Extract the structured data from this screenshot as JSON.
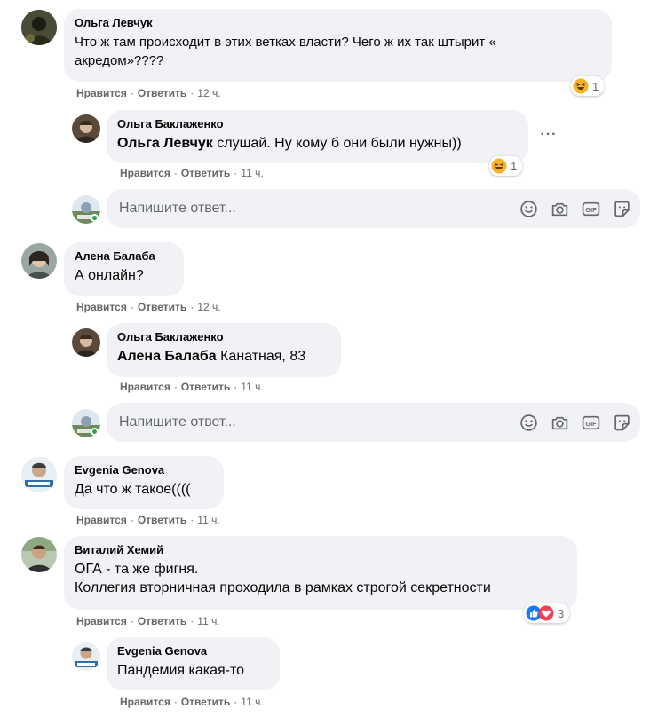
{
  "actions": {
    "like": "Нравится",
    "reply": "Ответить",
    "separator": "·"
  },
  "reply_input": {
    "placeholder": "Напишите ответ..."
  },
  "comments": [
    {
      "author": "Ольга Левчук",
      "text_line1": "Что ж там происходит в этих ветках власти? Чего ж их так штырит «",
      "text_line2": "акредом»????",
      "time": "12 ч.",
      "reaction": {
        "type": "haha",
        "count": "1"
      },
      "replies": [
        {
          "author": "Ольга Баклаженко",
          "mention": "Ольга Левчук",
          "text": " слушай. Ну кому б они были нужны))",
          "time": "11 ч.",
          "reaction": {
            "type": "haha",
            "count": "1"
          }
        }
      ]
    },
    {
      "author": "Алена Балаба",
      "text": "А онлайн?",
      "time": "12 ч.",
      "replies": [
        {
          "author": "Ольга Баклаженко",
          "mention": "Алена Балаба",
          "text": " Канатная, 83",
          "time": "11 ч."
        }
      ]
    },
    {
      "author": "Evgenia Genova",
      "text": "Да что ж такое((((",
      "time": "11 ч."
    },
    {
      "author": "Виталий Хемий",
      "text_line1": "ОГА - та же фигня.",
      "text_line2": "Коллегия вторничная проходила в рамках строгой секретности",
      "time": "11 ч.",
      "reaction": {
        "type": "like-love",
        "count": "3"
      },
      "replies": [
        {
          "author": "Evgenia Genova",
          "text": "Пандемия какая-то",
          "time": "11 ч."
        }
      ]
    }
  ],
  "colors": {
    "bubble": "#f0f2f5",
    "meta": "#65676b",
    "online": "#31a24c",
    "like": "#1877f2",
    "love": "#f33e58",
    "haha": "#f7b125"
  },
  "icons": [
    "emoji-icon",
    "camera-icon",
    "gif-icon",
    "sticker-icon",
    "haha-reaction-icon",
    "like-reaction-icon",
    "love-reaction-icon",
    "more-options-icon"
  ]
}
